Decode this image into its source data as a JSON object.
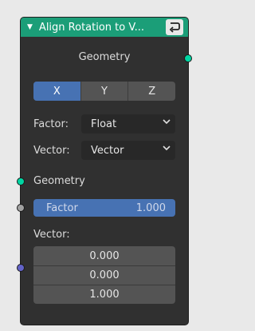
{
  "node": {
    "title": "Align Rotation to V...",
    "output_label": "Geometry",
    "axis_options": [
      "X",
      "Y",
      "Z"
    ],
    "selected_axis": "X",
    "factor_row": {
      "label": "Factor:",
      "value": "Float"
    },
    "vector_row": {
      "label": "Vector:",
      "value": "Vector"
    },
    "geometry_input_label": "Geometry",
    "factor_input": {
      "label": "Factor",
      "value": "1.000"
    },
    "vector_input_label": "Vector:",
    "vector_values": [
      "0.000",
      "0.000",
      "1.000"
    ]
  },
  "colors": {
    "header": "#1b9e78",
    "accent": "#4772b3",
    "geometry_socket": "#00d6a3",
    "float_socket": "#a1a1a1",
    "vector_socket": "#6363c7"
  },
  "icons": {
    "collapse": "triangle-down",
    "header_action": "return-arrow"
  }
}
